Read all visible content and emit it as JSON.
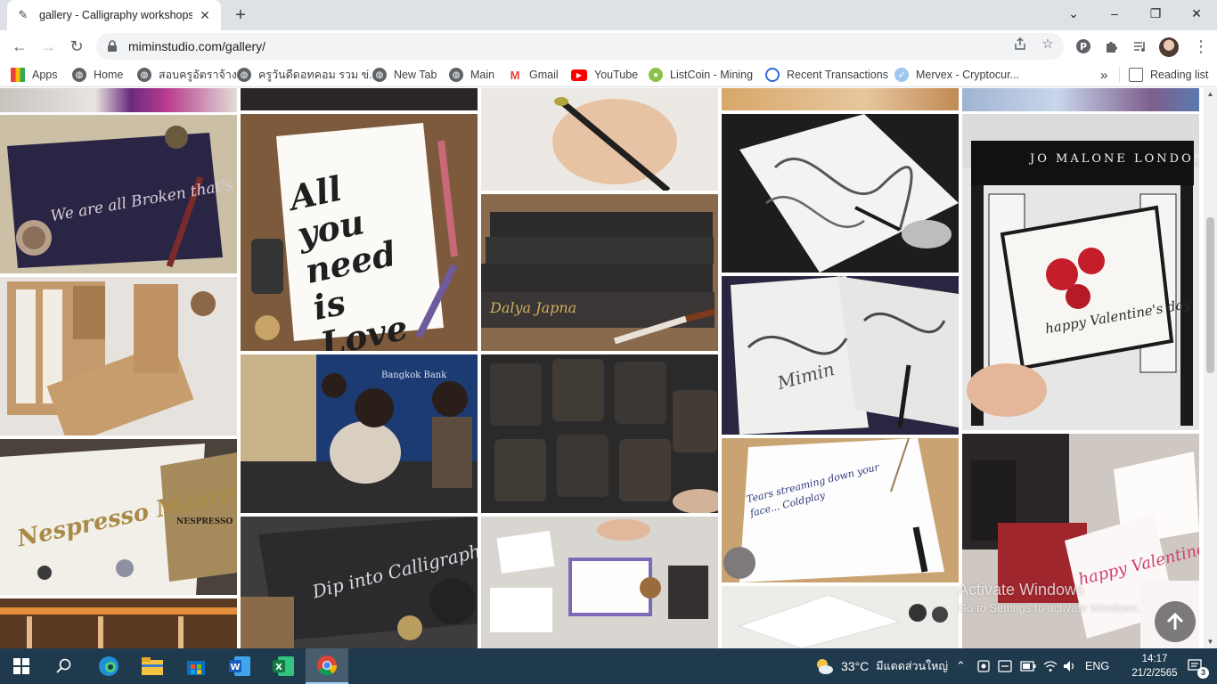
{
  "browser": {
    "tab": {
      "title": "gallery - Calligraphy workshops a",
      "close": "✕"
    },
    "new_tab": "+",
    "window": {
      "minimize": "⌄",
      "restore": "–",
      "maximize": "❐",
      "close": "✕"
    },
    "nav": {
      "back": "←",
      "forward": "→",
      "reload": "↻"
    },
    "url": "miminstudio.com/gallery/",
    "bookmarks": [
      {
        "label": "Apps",
        "icon": "apps-grid-icon"
      },
      {
        "label": "Home",
        "icon": "globe-icon"
      },
      {
        "label": "สอบครูอัตราจ้าง",
        "icon": "globe-icon"
      },
      {
        "label": "ครูวันดีดอทคอม รวม ข่...",
        "icon": "globe-icon"
      },
      {
        "label": "New Tab",
        "icon": "globe-icon"
      },
      {
        "label": "Main",
        "icon": "globe-icon"
      },
      {
        "label": "Gmail",
        "icon": "gmail-icon"
      },
      {
        "label": "YouTube",
        "icon": "youtube-icon"
      },
      {
        "label": "ListCoin - Mining",
        "icon": "listcoin-icon"
      },
      {
        "label": "Recent Transactions",
        "icon": "recent-transactions-icon"
      },
      {
        "label": "Mervex - Cryptocur...",
        "icon": "mervex-icon"
      }
    ],
    "bookmarks_overflow": "»",
    "reading_list": "Reading list"
  },
  "gallery": {
    "tiles": [
      {
        "caption": "We are all Broken that's how the Light gets in"
      },
      {
        "caption": "All you need is Love"
      },
      {
        "caption": ""
      },
      {
        "caption": "Dalya  Japna"
      },
      {
        "caption": ""
      },
      {
        "caption": ""
      },
      {
        "caption": "Mimin"
      },
      {
        "caption": "JO MALONE LONDON"
      },
      {
        "caption": "happy Valentine's day"
      },
      {
        "caption": "Nespresso Master Origin"
      },
      {
        "caption": "NESPRESSO"
      },
      {
        "caption": "Bangkok Bank"
      },
      {
        "caption": ""
      },
      {
        "caption": "Tears streaming down your face... Coldplay"
      },
      {
        "caption": "happy Valentine's day"
      },
      {
        "caption": ""
      },
      {
        "caption": "Dip into Calligraphy"
      },
      {
        "caption": ""
      },
      {
        "caption": ""
      }
    ]
  },
  "overlay": {
    "activate_title": "Activate Windows",
    "activate_sub": "Go to Settings to activate Windows.",
    "scroll_top": "🡡"
  },
  "taskbar": {
    "weather_temp": "33°C",
    "weather_text": "มีแดดส่วนใหญ่",
    "language": "ENG",
    "time": "14:17",
    "date": "21/2/2565",
    "notifications": "3"
  }
}
